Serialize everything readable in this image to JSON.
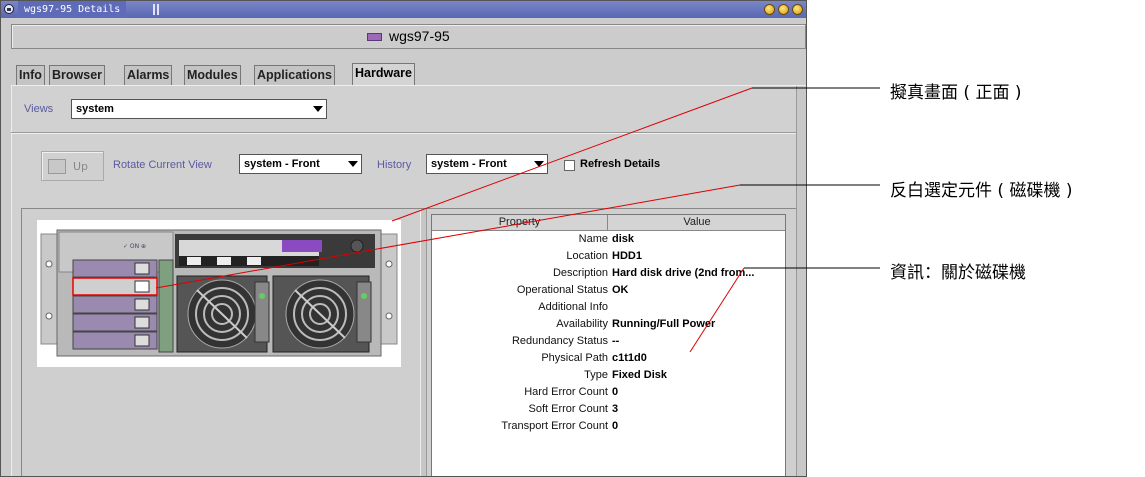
{
  "window": {
    "title": "wgs97-95 Details"
  },
  "heading": {
    "host": "wgs97-95"
  },
  "tabs": [
    {
      "label": "Info"
    },
    {
      "label": "Browser"
    },
    {
      "label": "Alarms"
    },
    {
      "label": "Modules"
    },
    {
      "label": "Applications"
    },
    {
      "label": "Hardware"
    }
  ],
  "active_tab": "Hardware",
  "views": {
    "label": "Views",
    "selected": "system"
  },
  "toolbar": {
    "up_label": "Up",
    "rotate_label": "Rotate Current View",
    "rotate_selected": "system - Front",
    "history_label": "History",
    "history_selected": "system - Front",
    "refresh_label": "Refresh Details",
    "refresh_checked": false
  },
  "properties": {
    "header_property": "Property",
    "header_value": "Value",
    "rows": [
      {
        "key": "Name",
        "value": "disk"
      },
      {
        "key": "Location",
        "value": "HDD1"
      },
      {
        "key": "Description",
        "value": "Hard disk drive (2nd from..."
      },
      {
        "key": "Operational Status",
        "value": "OK"
      },
      {
        "key": "Additional Info",
        "value": ""
      },
      {
        "key": "Availability",
        "value": "Running/Full Power"
      },
      {
        "key": "Redundancy Status",
        "value": "--"
      },
      {
        "key": "Physical Path",
        "value": "c1t1d0"
      },
      {
        "key": "Type",
        "value": "Fixed Disk"
      },
      {
        "key": "Hard Error Count",
        "value": "0"
      },
      {
        "key": "Soft Error Count",
        "value": "3"
      },
      {
        "key": "Transport Error Count",
        "value": "0"
      }
    ]
  },
  "callouts": {
    "front_view": "擬真畫面 ( 正面 )",
    "highlight": "反白選定元件 ( 磁碟機 )",
    "info": "資訊：關於磁碟機"
  },
  "colors": {
    "titlebar": "#5e6bb8",
    "leader_line": "#dd0000",
    "label_blue": "#5a5aa0"
  }
}
